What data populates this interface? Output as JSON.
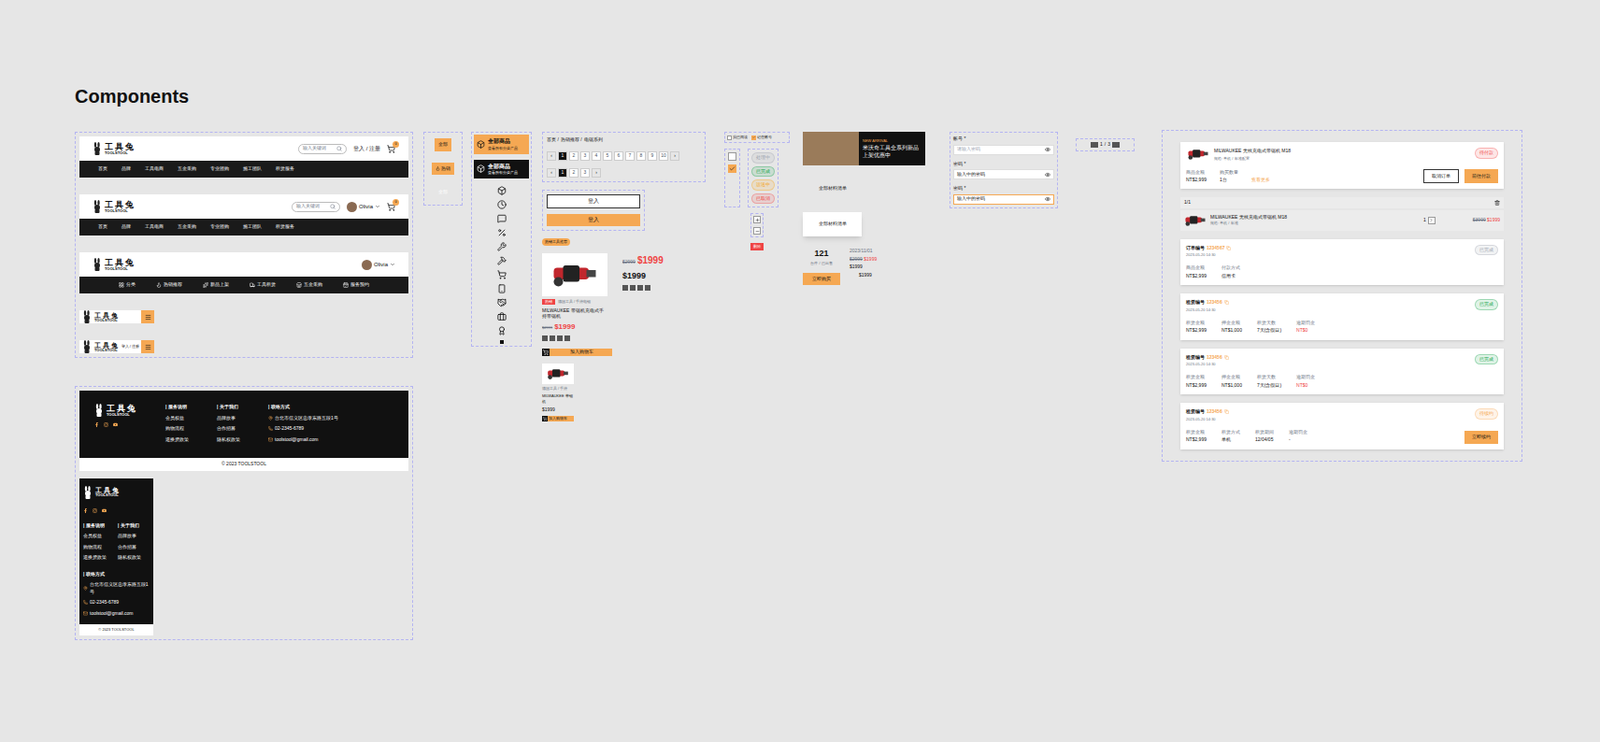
{
  "title": "Components",
  "brand": {
    "name": "工具兔",
    "sub": "TOOLSTOOL"
  },
  "headers": [
    {
      "kind": "guest",
      "search": "输入关键词",
      "login": "登入 / 注册",
      "cart": "0",
      "nav": [
        "首页",
        "品牌",
        "工具电商",
        "五金采购",
        "专业团购",
        "施工团队",
        "租赁服务"
      ]
    },
    {
      "kind": "member",
      "search": "输入关键词",
      "user": "Olivia",
      "cart": "0",
      "nav": [
        "首页",
        "品牌",
        "工具电商",
        "五金采购",
        "专业团购",
        "施工团队",
        "租赁服务"
      ]
    },
    {
      "kind": "icons",
      "user": "Olivia",
      "nav": [
        "分类",
        "热销推荐",
        "新品上架",
        "工具租赁",
        "五金采购",
        "服务预约"
      ]
    }
  ],
  "mobile_headers": [
    {
      "kind": "menu",
      "login": ""
    },
    {
      "kind": "login",
      "login": "登入 / 注册"
    }
  ],
  "footer": {
    "columns": [
      {
        "title": "服务说明",
        "items": [
          "会员权益",
          "购物流程",
          "退换货政策"
        ]
      },
      {
        "title": "关于我们",
        "items": [
          "品牌故事",
          "合作招募",
          "隐私权政策"
        ]
      }
    ],
    "contact_title": "联络方式",
    "address": "台北市信义区忠孝东路五段1号",
    "phone": "02-2345-6789",
    "email": "toolstool@gmail.com",
    "copyright": "© 2023 TOOLSTOOL"
  },
  "chips": [
    {
      "label": "全部",
      "selected": true,
      "disabled": false
    },
    {
      "label": "热销",
      "selected": true,
      "disabled": false
    },
    {
      "label": "全部",
      "selected": false,
      "disabled": true
    }
  ],
  "category_cards": [
    {
      "title": "全部商品",
      "sub": "查看所有分类产品",
      "selected": true
    },
    {
      "title": "全部商品",
      "sub": "查看所有分类产品",
      "selected": false
    }
  ],
  "breadcrumb": {
    "items": [
      "首页",
      "热销推荐",
      "电锯系列"
    ],
    "sep": "/"
  },
  "pagers": [
    {
      "prev": "‹",
      "next": "›",
      "pages": [
        {
          "label": "1",
          "selected": true
        },
        {
          "label": "2",
          "selected": false
        },
        {
          "label": "3",
          "selected": false
        },
        {
          "label": "4",
          "selected": false
        },
        {
          "label": "5",
          "selected": false
        },
        {
          "label": "6",
          "selected": false
        },
        {
          "label": "7",
          "selected": false
        },
        {
          "label": "8",
          "selected": false
        },
        {
          "label": "9",
          "selected": false
        },
        {
          "label": "10",
          "selected": false
        }
      ]
    },
    {
      "prev": "‹",
      "next": "›",
      "pages": [
        {
          "label": "1",
          "selected": true
        },
        {
          "label": "2",
          "selected": false
        },
        {
          "label": "3",
          "selected": false
        }
      ]
    }
  ],
  "buttons": [
    {
      "label": "登入",
      "kind": "outline"
    },
    {
      "label": "登入",
      "kind": "primary"
    }
  ],
  "hot_tag": "热销工具推荐",
  "product": {
    "badge": "热销",
    "category": "德国工具 / 手持电锯",
    "name": "MILWAUKEE 带锯机充电式手持带锯机",
    "old_price": "$2999",
    "price": "$1999",
    "cart": "加入购物车"
  },
  "price_block": {
    "old": "$2999",
    "price": "$1999",
    "price2": "$1999"
  },
  "small_product": {
    "category": "德国工具 / 手持",
    "name": "MILWAUKEE 带锯机",
    "price": "$1999",
    "cart": "加入购物车"
  },
  "checks": [
    {
      "label": "我已阅读",
      "checked": false
    },
    {
      "label": "记住帐号",
      "checked": true
    }
  ],
  "boxes": [
    {
      "checked": false
    },
    {
      "checked": true
    }
  ],
  "statuses": [
    {
      "label": "处理中",
      "color": "#9ca3af"
    },
    {
      "label": "已完成",
      "color": "#16a34a"
    },
    {
      "label": "运送中",
      "color": "#f59e0b"
    },
    {
      "label": "已取消",
      "color": "#ef4444"
    }
  ],
  "delete_tag": "删除",
  "banner": {
    "eyebrow": "NEW ARRIVAL",
    "title": "米沃奇工具全系列新品上架优惠中"
  },
  "material_cards": [
    {
      "label": "全部材料清单",
      "selected": false
    },
    {
      "label": "全部材料清单",
      "selected": true
    }
  ],
  "stat": {
    "value": "121",
    "label": "台件 / 已出售"
  },
  "deal": {
    "date": "2023/11/01",
    "old": "$2999",
    "price": "$1999",
    "p2": "$1999",
    "p3": "$1999"
  },
  "buy": "立即购买",
  "fields": [
    {
      "label": "帐号 *",
      "value": "请输入密码",
      "filled": false,
      "focused": false
    },
    {
      "label": "密码 *",
      "value": "输入中的密码",
      "filled": true,
      "focused": false
    },
    {
      "label": "密码 *",
      "value": "输入中的密码",
      "filled": true,
      "focused": true
    }
  ],
  "mini_pager": [
    "1",
    "/",
    "3"
  ],
  "cart_item": {
    "name": "MILWAUKEE 无线充电式带锯机 M18",
    "spec": "规格: 单机 / 标准配置",
    "tag": {
      "label": "待付款",
      "color": "#ef4444"
    },
    "fields": [
      {
        "label": "商品金额",
        "value": "NT$2,999"
      },
      {
        "label": "购买数量",
        "value": "1台"
      }
    ],
    "link": "查看更多",
    "actions": [
      {
        "label": "取消订单",
        "kind": "outline"
      },
      {
        "label": "前往付款",
        "kind": "primary"
      }
    ]
  },
  "cart_row": {
    "count": "1/1",
    "name": "MILWAUKEE 无线充电式带锯机 M18",
    "spec": "规格: 单机 / 标准",
    "qty": "1",
    "old": "$3999",
    "price": "$1999"
  },
  "orders": [
    {
      "label": "订单编号",
      "number": "1234567",
      "date": "2023-05-20 14:30",
      "tag": {
        "label": "已完成",
        "color": "#9ca3af"
      },
      "fields": [
        {
          "label": "商品金额",
          "value": "NT$2,999",
          "alert": false
        },
        {
          "label": "付款方式",
          "value": "信用卡",
          "alert": false
        }
      ],
      "action": ""
    },
    {
      "label": "租赁编号",
      "number": "123456",
      "date": "2023-05-20 14:30",
      "tag": {
        "label": "已完成",
        "color": "#16a34a"
      },
      "fields": [
        {
          "label": "租赁金额",
          "value": "NT$2,999",
          "alert": false
        },
        {
          "label": "押金金额",
          "value": "NT$1,000",
          "alert": false
        },
        {
          "label": "租赁天数",
          "value": "7天(含假日)",
          "alert": false
        },
        {
          "label": "逾期罚金",
          "value": "NT$0",
          "alert": true
        }
      ],
      "action": ""
    },
    {
      "label": "租赁编号",
      "number": "123456",
      "date": "2023-05-20 14:30",
      "tag": {
        "label": "已完成",
        "color": "#16a34a"
      },
      "fields": [
        {
          "label": "租赁金额",
          "value": "NT$2,999",
          "alert": false
        },
        {
          "label": "押金金额",
          "value": "NT$1,000",
          "alert": false
        },
        {
          "label": "租赁天数",
          "value": "7天(含假日)",
          "alert": false
        },
        {
          "label": "逾期罚金",
          "value": "NT$0",
          "alert": true
        }
      ],
      "action": ""
    },
    {
      "label": "租赁编号",
      "number": "123456",
      "date": "2023-05-20 14:30",
      "tag": {
        "label": "待续约",
        "color": "#f5a853"
      },
      "fields": [
        {
          "label": "租赁金额",
          "value": "NT$2,999",
          "alert": false
        },
        {
          "label": "租赁方式",
          "value": "单机",
          "alert": false
        },
        {
          "label": "租赁期间",
          "value": "12/04/05",
          "alert": false
        },
        {
          "label": "逾期罚金",
          "value": "-",
          "alert": false
        }
      ],
      "action": "立即续约"
    }
  ]
}
